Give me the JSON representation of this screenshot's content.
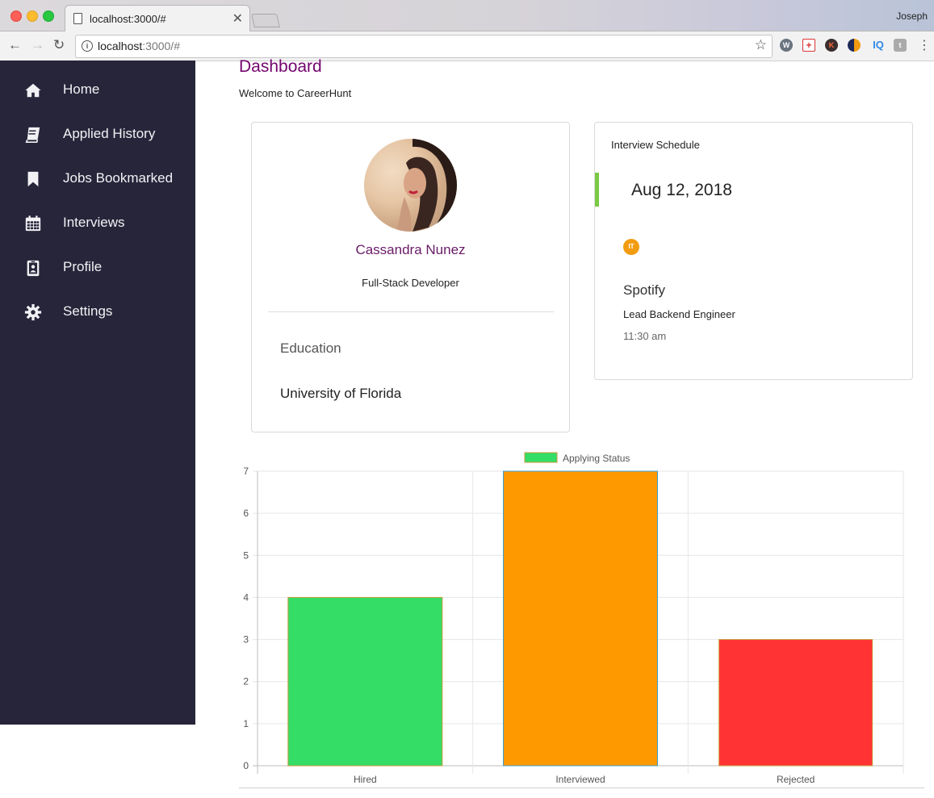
{
  "browser": {
    "tab_title": "localhost:3000/#",
    "url_host": "localhost",
    "url_path": ":3000/#",
    "profile_name": "Joseph",
    "extensions": [
      "W",
      "+",
      "K",
      "",
      "IQ",
      "t"
    ]
  },
  "sidebar": {
    "background": "#27253a",
    "items": [
      {
        "label": "Home",
        "icon": "home-icon"
      },
      {
        "label": "Applied History",
        "icon": "book-icon"
      },
      {
        "label": "Jobs Bookmarked",
        "icon": "bookmark-icon"
      },
      {
        "label": "Interviews",
        "icon": "calendar-icon"
      },
      {
        "label": "Profile",
        "icon": "id-badge-icon"
      },
      {
        "label": "Settings",
        "icon": "gear-icon"
      }
    ]
  },
  "main": {
    "title": "Dashboard",
    "subtitle": "Welcome to CareerHunt",
    "accent": "#74066f"
  },
  "profile": {
    "name": "Cassandra Nunez",
    "role": "Full-Stack Developer",
    "education_label": "Education",
    "education_value": "University of Florida"
  },
  "interview": {
    "title": "Interview Schedule",
    "date": "Aug 12, 2018",
    "badge": "IT",
    "company": "Spotify",
    "position": "Lead Backend Engineer",
    "time": "11:30 am",
    "bar_color": "#7ac943",
    "badge_color": "#f39c12"
  },
  "chart_data": {
    "type": "bar",
    "categories": [
      "Hired",
      "Interviewed",
      "Rejected"
    ],
    "series": [
      {
        "name": "Applying Status",
        "values": [
          4,
          7,
          3
        ]
      }
    ],
    "colors": [
      "#33dd66",
      "#ff9900",
      "#ff3333"
    ],
    "legend_color": "#33dd66",
    "ylim": [
      0,
      7
    ],
    "yticks": [
      0,
      1,
      2,
      3,
      4,
      5,
      6,
      7
    ],
    "grid": true,
    "legend": "top-center"
  }
}
